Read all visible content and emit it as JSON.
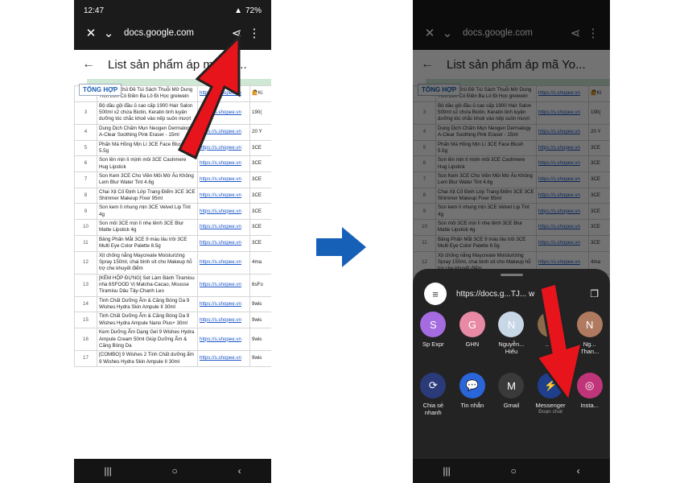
{
  "status": {
    "time": "12:47",
    "battery": "72%"
  },
  "browser": {
    "url": "docs.google.com"
  },
  "sheet": {
    "title": "List sản phẩm áp mã Yo...",
    "tab": "TỔNG HỢP"
  },
  "rows": [
    {
      "n": "2",
      "name": "Đồ Chơi Chủ Đề Túi Sách Thuỗi Mở Dung Tích Lớn Có Điền Ba Lô Đi Học greiwein",
      "link": "https://s.shopee.vn",
      "extra": "🙋Ki"
    },
    {
      "n": "3",
      "name": "Bộ dầu gội đầu ủ cao cấp 1900 Hair Salon 500ml x2 chứa Biotin, Keratin tinh luyện dưỡng tóc chắc khoẻ vào nếp suôn mượt",
      "link": "https://s.shopee.vn",
      "extra": "190("
    },
    {
      "n": "4",
      "name": "Dung Dịch Chấm Mụn Neogen Dermalogy A-Clear Soothing Pink Eraser - 15ml",
      "link": "https://s.shopee.vn",
      "extra": "20 Y"
    },
    {
      "n": "5",
      "name": "Phấn Má Hồng Mịn Lì 3CE Face Blush 5.5g",
      "link": "https://s.shopee.vn",
      "extra": "3CE"
    },
    {
      "n": "6",
      "name": "Son lên mịn lì mịnh môi 3CE Cashmere Hug Lipstick",
      "link": "https://s.shopee.vn",
      "extra": "3CE"
    },
    {
      "n": "7",
      "name": "Son Kem 3CE Cho Viền Môi Mờ Ảo Không Lem Blur Water Tint 4.6g",
      "link": "https://s.shopee.vn",
      "extra": "3CE"
    },
    {
      "n": "8",
      "name": "Chai Xịt Cố Định Lớp Trang Điểm 3CE 3CE Shimmer Makeup Fixer 95ml",
      "link": "https://s.shopee.vn",
      "extra": "3CE"
    },
    {
      "n": "9",
      "name": "Son kem lì nhung mịn 3CE Velvet Lip Tint 4g",
      "link": "https://s.shopee.vn",
      "extra": "3CE"
    },
    {
      "n": "10",
      "name": "Son môi 3CE mịn lì nhẹ tênh 3CE Blur Matte Lipstick 4g",
      "link": "https://s.shopee.vn",
      "extra": "3CE"
    },
    {
      "n": "11",
      "name": "Bảng Phấn Mắt 3CE 9 màu lâu trôi 3CE Multi Eye Color Palette 8.5g",
      "link": "https://s.shopee.vn",
      "extra": "3CE"
    },
    {
      "n": "12",
      "name": "Xịt chống nắng Maycreate Moisturizing Spray 150ml, chai bình sít cho Makeup hỗ trợ che khuyết điểm",
      "link": "https://s.shopee.vn",
      "extra": "4ma"
    },
    {
      "n": "13",
      "name": "[KÈM HỘP ĐỰNG] Set Làm Bánh Tiramisu nhà 6SFOOD Vị Matcha-Cacao, Mousse Tiramisu Dâu Tây-Chanh Leo",
      "link": "https://s.shopee.vn",
      "extra": "6sFo"
    },
    {
      "n": "14",
      "name": "Tinh Chất Dưỡng Ẩm & Căng Bóng Da 9 Wishes Hydra Skin Ampule II 30ml",
      "link": "https://s.shopee.vn",
      "extra": "9wis"
    },
    {
      "n": "15",
      "name": "Tinh Chất Dưỡng Ẩm & Căng Bóng Da 9 Wishes Hydra Ampule Nano Plus+ 30ml",
      "link": "https://s.shopee.vn",
      "extra": "9wis"
    },
    {
      "n": "16",
      "name": "Kem Dưỡng Ẩm Dạng Gel 9 Wishes Hydra Ampule Cream 50ml Giúp Dưỡng Ẩm & Căng Bóng Da",
      "link": "https://s.shopee.vn",
      "extra": "9wis"
    },
    {
      "n": "17",
      "name": "[COMBO] 9 Wishes 2 Tinh Chất dưỡng ẩm 9 Wishes Hydra Skin Ampule II 30ml",
      "link": "https://s.shopee.vn",
      "extra": "9wis"
    }
  ],
  "share": {
    "url": "https://docs.g...TJ... w",
    "contacts": [
      {
        "label": "Sp Expr",
        "initial": "S",
        "color": "#a56be0"
      },
      {
        "label": "GHN",
        "initial": "G",
        "color": "#e88aa6"
      },
      {
        "label": "Nguyễn... Hiếu",
        "initial": "N",
        "color": "#c8d7e6"
      },
      {
        "label": "...tn",
        "initial": "T",
        "color": "#8a6a4a"
      },
      {
        "label": "Ng... Than...",
        "initial": "N",
        "color": "#b07a60"
      }
    ],
    "apps": [
      {
        "label": "Chia sẻ nhanh",
        "sub": "",
        "icon": "⟳",
        "color": "#2b3b7a"
      },
      {
        "label": "Tin nhắn",
        "sub": "",
        "icon": "💬",
        "color": "#2a66d9"
      },
      {
        "label": "Gmail",
        "sub": "",
        "icon": "M",
        "color": "#3a3a3a"
      },
      {
        "label": "Messenger",
        "sub": "Đoạn chat",
        "icon": "⚡",
        "color": "#1f3e8c"
      },
      {
        "label": "Insta...",
        "sub": "",
        "icon": "◎",
        "color": "#c0357a"
      }
    ]
  },
  "colors": {
    "arrow_red": "#e8141c",
    "arrow_blue": "#1760b8"
  }
}
